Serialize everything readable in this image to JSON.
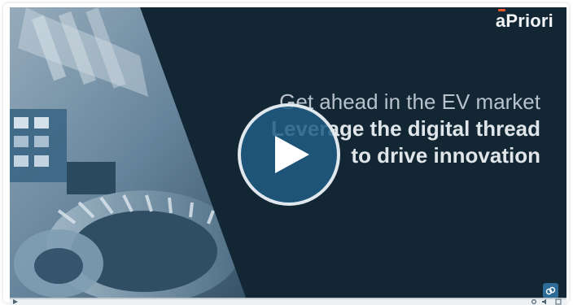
{
  "brand": {
    "logo_text": "aPriori",
    "logo_accent_color": "#e8562a"
  },
  "headline": {
    "line1": "Get ahead in the EV market",
    "line2": "Leverage the digital thread",
    "line3": "to drive innovation"
  },
  "colors": {
    "background": "#132633",
    "play_button": "#1f5c82",
    "link_button": "#2c6c96",
    "headline_light": "#b7c2cb",
    "headline_bold": "#dfe5e9"
  },
  "video": {
    "progress": 0.0,
    "icons": [
      "play-icon",
      "link-icon",
      "settings-icon",
      "volume-icon",
      "fullscreen-icon",
      "small-play-icon"
    ]
  }
}
